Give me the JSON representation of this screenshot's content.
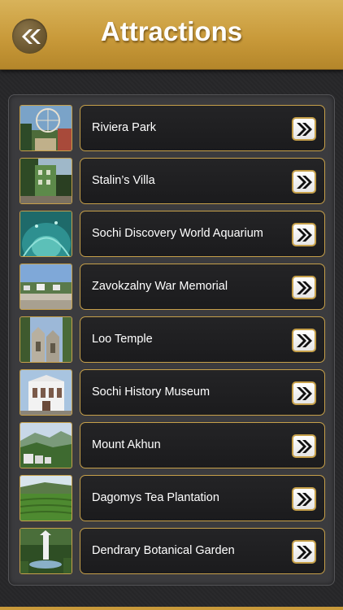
{
  "header": {
    "title": "Attractions",
    "back_icon": "double-chevron-left-icon",
    "accent": "#c99a3a"
  },
  "attractions": [
    {
      "name": "Riviera Park",
      "thumb": "ferris-wheel-park"
    },
    {
      "name": "Stalin’s Villa",
      "thumb": "green-villa"
    },
    {
      "name": "Sochi Discovery World Aquarium",
      "thumb": "aquarium-tunnel"
    },
    {
      "name": "Zavokzalny War Memorial",
      "thumb": "city-view"
    },
    {
      "name": "Loo Temple",
      "thumb": "ruins"
    },
    {
      "name": "Sochi History Museum",
      "thumb": "museum-building"
    },
    {
      "name": "Mount Akhun",
      "thumb": "mountain-view"
    },
    {
      "name": "Dagomys Tea Plantation",
      "thumb": "tea-field"
    },
    {
      "name": "Dendrary Botanical Garden",
      "thumb": "garden-fountain"
    }
  ],
  "colors": {
    "gold_border": "#c6a04a",
    "item_bg": "#1e1e20",
    "panel_bg": "#3b3b3e"
  }
}
